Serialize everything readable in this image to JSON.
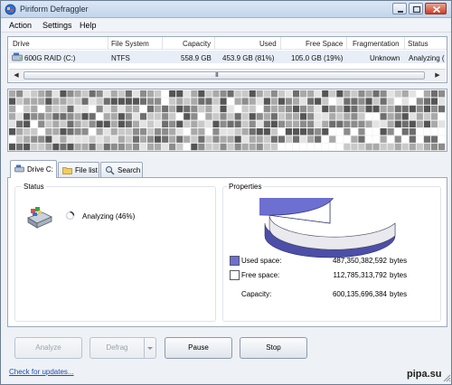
{
  "window": {
    "title": "Piriform Defraggler"
  },
  "menu": [
    "Action",
    "Settings",
    "Help"
  ],
  "drive_table": {
    "columns": [
      "Drive",
      "File System",
      "Capacity",
      "Used",
      "Free Space",
      "Fragmentation",
      "Status"
    ],
    "rows": [
      {
        "drive": "600G RAID (C:)",
        "file_system": "NTFS",
        "capacity": "558.9 GB",
        "used": "453.9 GB (81%)",
        "free_space": "105.0 GB (19%)",
        "fragmentation": "Unknown",
        "status": "Analyzing ("
      }
    ],
    "scroll_grip": "III"
  },
  "tabs": [
    {
      "label": "Drive C:",
      "icon": "drive-icon",
      "active": true
    },
    {
      "label": "File list",
      "icon": "folder-icon",
      "active": false
    },
    {
      "label": "Search",
      "icon": "search-icon",
      "active": false
    }
  ],
  "status_group": {
    "title": "Status",
    "text": "Analyzing (46%)",
    "progress_percent": 46
  },
  "properties_group": {
    "title": "Properties",
    "used_fraction": 0.81,
    "colors": {
      "used": "#6d6fd1",
      "free": "#ffffff"
    },
    "rows": [
      {
        "label": "Used space:",
        "value": "487,350,382,592",
        "unit": "bytes"
      },
      {
        "label": "Free space:",
        "value": "112,785,313,792",
        "unit": "bytes"
      },
      {
        "label": "Capacity:",
        "value": "600,135,696,384",
        "unit": "bytes"
      }
    ]
  },
  "buttons": {
    "analyze": "Analyze",
    "defrag": "Defrag",
    "pause": "Pause",
    "stop": "Stop"
  },
  "footer": {
    "update_link": "Check for updates..."
  },
  "watermark": "pipa.su"
}
